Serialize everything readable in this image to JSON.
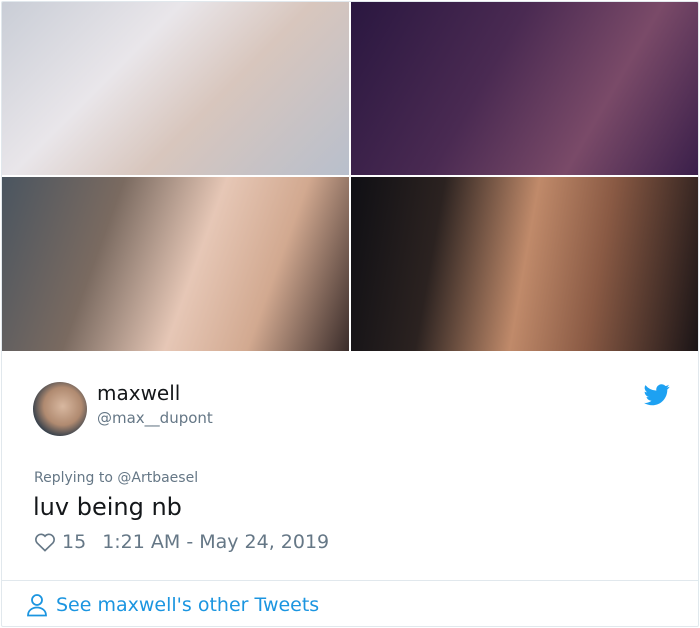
{
  "tweet": {
    "display_name": "maxwell",
    "handle": "@max__dupont",
    "replying_prefix": "Replying to ",
    "replying_to": "@Artbaesel",
    "text": "luv being nb",
    "likes": "15",
    "timestamp": "1:21 AM - May 24, 2019",
    "see_more": "See maxwell's other Tweets"
  },
  "icons": {
    "brand": "twitter-bird-icon",
    "like": "heart-icon",
    "profile": "person-icon"
  },
  "colors": {
    "accent": "#1b95e0",
    "text": "#14171a",
    "muted": "#657786",
    "border": "#e1e8ed"
  }
}
